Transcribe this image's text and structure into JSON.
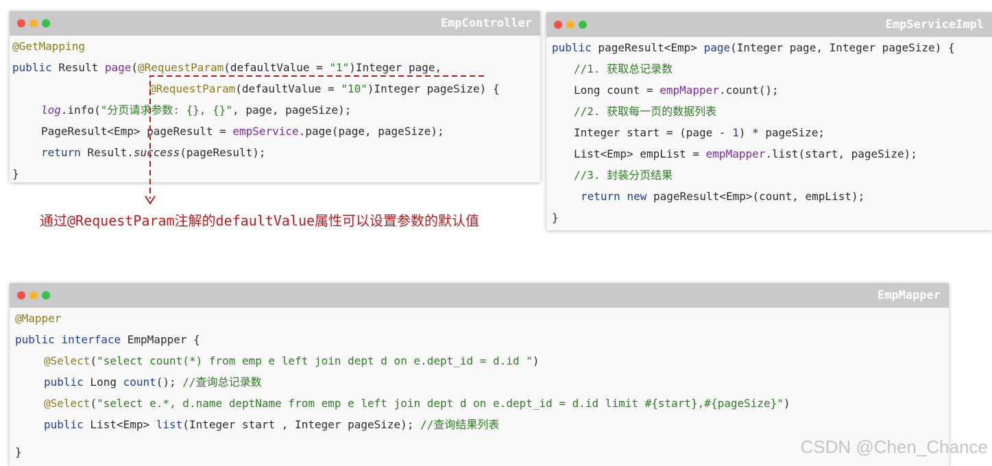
{
  "windows": {
    "controller": {
      "title": "EmpController",
      "lines": {
        "l1": "@GetMapping",
        "l2_kw": "public",
        "l2_a": " Result ",
        "l2_fn": "page",
        "l2_b": "(",
        "l2_ann": "@RequestParam",
        "l2_c": "(defaultValue = ",
        "l2_str": "\"1\"",
        "l2_d": ")Integer page,",
        "l3_ann": "@RequestParam",
        "l3_a": "(defaultValue = ",
        "l3_str": "\"10\"",
        "l3_b": ")Integer pageSize) {",
        "l4_it": "log",
        "l4_a": ".info(",
        "l4_str": "\"分页请求参数: {}, {}\"",
        "l4_b": ", page, pageSize);",
        "l5_a": "PageResult<Emp> pageResult = ",
        "l5_fn": "empService",
        "l5_b": ".page(page, pageSize);",
        "l6_kw": "return",
        "l6_a": " Result.",
        "l6_it": "success",
        "l6_b": "(pageResult);",
        "l7": "}"
      }
    },
    "service": {
      "title": "EmpServiceImpl",
      "lines": {
        "l1_kw": "public",
        "l1_a": " pageResult<Emp> ",
        "l1_fn": "page",
        "l1_b": "(Integer page, Integer pageSize) {",
        "l2": "//1. 获取总记录数",
        "l3_a": "Long count = ",
        "l3_fn": "empMapper",
        "l3_b": ".count();",
        "l4": "//2. 获取每一页的数据列表",
        "l5_a": "Integer start = (page - ",
        "l5_num": "1",
        "l5_b": ") * pageSize;",
        "l6_a": "List<Emp> empList = ",
        "l6_fn": "empMapper",
        "l6_b": ".list(start, pageSize);",
        "l7": "//3. 封装分页结果",
        "l8_kw1": "return",
        "l8_sp": " ",
        "l8_kw2": "new",
        "l8_a": " pageResult<Emp>(count, empList);",
        "l9": "}"
      }
    },
    "mapper": {
      "title": "EmpMapper",
      "lines": {
        "l1": "@Mapper",
        "l2_kw1": "public",
        "l2_sp": " ",
        "l2_kw2": "interface",
        "l2_a": " EmpMapper {",
        "l3_ann": "@Select",
        "l3_a": "(",
        "l3_str": "\"select count(*) from emp e left join dept d on e.dept_id = d.id \"",
        "l3_b": ")",
        "l4_kw": "public",
        "l4_a": " Long ",
        "l4_fn": "count",
        "l4_b": "(); ",
        "l4_com": "//查询总记录数",
        "l5_ann": "@Select",
        "l5_a": "(",
        "l5_str": "\"select e.*, d.name deptName from emp e left join dept d on e.dept_id = d.id limit #{start},#{pageSize}\"",
        "l5_b": ")",
        "l6_kw": "public",
        "l6_a": " List<Emp> ",
        "l6_fn": "list",
        "l6_b": "(Integer start , Integer pageSize); ",
        "l6_com": "//查询结果列表",
        "l7": "}"
      }
    }
  },
  "annotation_note": "通过@RequestParam注解的defaultValue属性可以设置参数的默认值",
  "watermark": "CSDN @Chen_Chance",
  "colors": {
    "keyword": "#1f3f9a",
    "annotation": "#8e7b1a",
    "string": "#2e7d23",
    "method": "#7b2aa3",
    "note": "#c0181d",
    "titlebar": "#c9c9c9"
  }
}
